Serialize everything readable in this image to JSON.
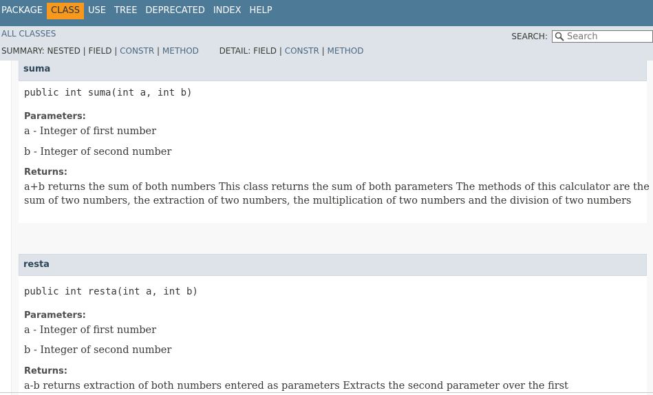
{
  "topnav": {
    "items": [
      "PACKAGE",
      "CLASS",
      "USE",
      "TREE",
      "DEPRECATED",
      "INDEX",
      "HELP"
    ],
    "active_index": 1
  },
  "subnav": {
    "all_classes": "ALL CLASSES",
    "search_label": "SEARCH:",
    "search_placeholder": "Search",
    "summary_prefix": "SUMMARY: NESTED | FIELD |",
    "summary_constr": "CONSTR",
    "summary_sep": "|",
    "summary_method": "METHOD",
    "detail_prefix": "DETAIL: FIELD |",
    "detail_constr": "CONSTR",
    "detail_sep": "|",
    "detail_method": "METHOD"
  },
  "methods": [
    {
      "name": "suma",
      "signature": "public int suma(int a, int b)",
      "parameters_label": "Parameters:",
      "param_a": "a - Integer of first number",
      "param_b": "b - Integer of second number",
      "returns_label": "Returns:",
      "returns_line1": "a+b returns the sum of both numbers This class returns the sum of both parameters The methods of this calculator are the",
      "returns_line2": "sum of two numbers, the extraction of two numbers, the multiplication of two numbers and the division of two numbers"
    },
    {
      "name": "resta",
      "signature": "public int resta(int a, int b)",
      "parameters_label": "Parameters:",
      "param_a": "a - Integer of first number",
      "param_b": "b - Integer of second number",
      "returns_label": "Returns:",
      "returns_line1": "a-b returns extraction of both numbers entered as parameters Extracts the second parameter over the first"
    }
  ],
  "colors": {
    "nav_bg": "#4d7a97",
    "active_bg": "#f8981d",
    "subnav_bg": "#dee3e9",
    "link": "#4a6782"
  }
}
